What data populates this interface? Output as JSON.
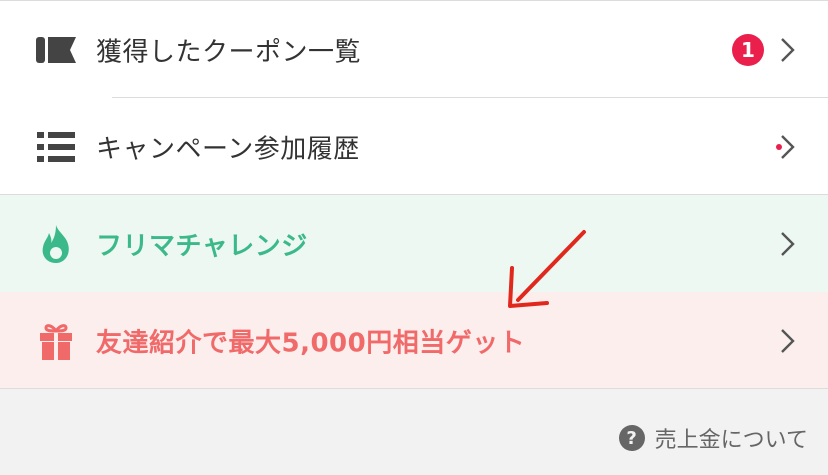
{
  "menu": {
    "items": [
      {
        "label": "獲得したクーポン一覧",
        "icon": "coupon-icon",
        "badge": "1"
      },
      {
        "label": "キャンペーン参加履歴",
        "icon": "list-icon"
      },
      {
        "label": "フリマチャレンジ",
        "icon": "flame-icon"
      },
      {
        "label": "友達紹介で最大5,000円相当ゲット",
        "icon": "gift-icon"
      }
    ]
  },
  "footer": {
    "help_icon": "?",
    "help_label": "売上金について"
  },
  "colors": {
    "badge": "#ea1f4b",
    "green_text": "#3cb98a",
    "green_bg": "#edf8f3",
    "pink_text": "#f06a6a",
    "pink_bg": "#fdeeee",
    "annotation_arrow": "#e0281c"
  }
}
